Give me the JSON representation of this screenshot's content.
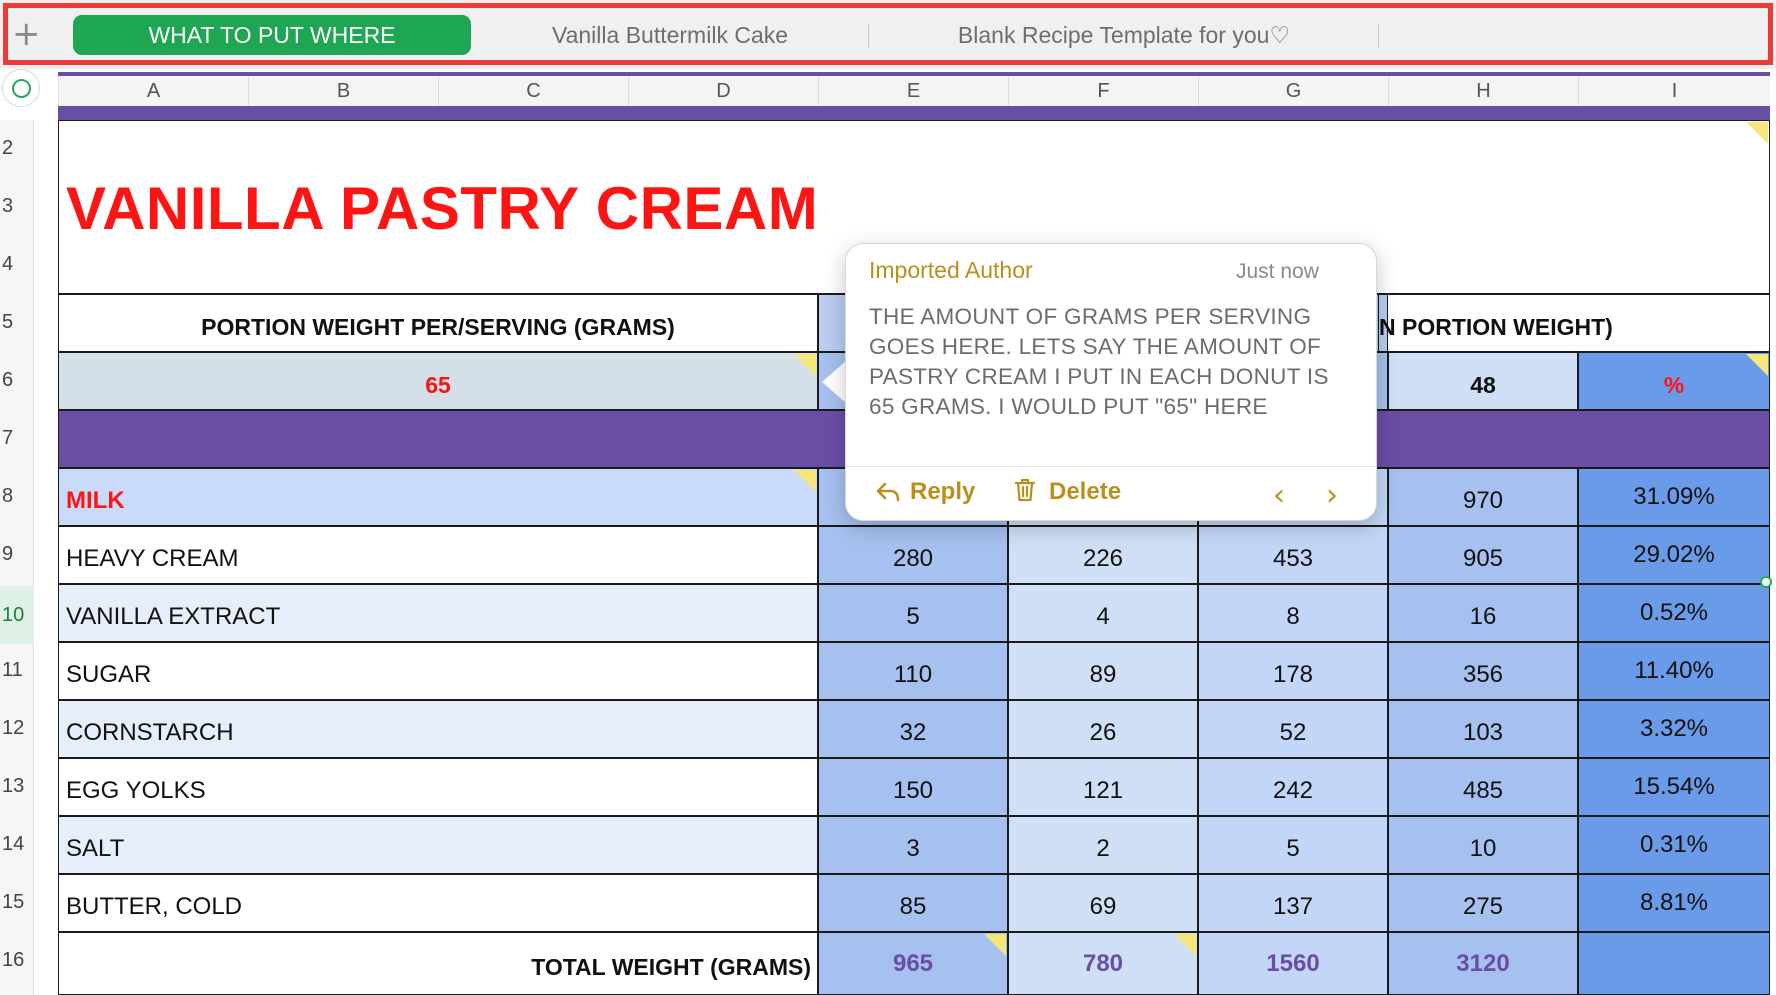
{
  "tabs": {
    "add_icon": "+",
    "items": [
      {
        "label": "WHAT TO PUT WHERE",
        "active": true
      },
      {
        "label": "Vanilla Buttermilk Cake",
        "active": false
      },
      {
        "label": "Blank Recipe Template for you♡",
        "active": false
      }
    ]
  },
  "columns": [
    "A",
    "B",
    "C",
    "D",
    "E",
    "F",
    "G",
    "H",
    "I"
  ],
  "rows": [
    "2",
    "3",
    "4",
    "5",
    "6",
    "7",
    "8",
    "9",
    "10",
    "11",
    "12",
    "13",
    "14",
    "15",
    "16"
  ],
  "sheet": {
    "title": "VANILLA PASTRY CREAM",
    "portion_label": "PORTION WEIGHT PER/SERVING (GRAMS)",
    "portion_value": "65",
    "h_header_fragment": "N PORTION WEIGHT)",
    "h6_value": "48",
    "i6_value": "%",
    "ingredients": [
      {
        "name": "MILK",
        "e": "",
        "f": "",
        "g": "",
        "h": "970",
        "pct": "31.09%"
      },
      {
        "name": "HEAVY CREAM",
        "e": "280",
        "f": "226",
        "g": "453",
        "h": "905",
        "pct": "29.02%"
      },
      {
        "name": "VANILLA EXTRACT",
        "e": "5",
        "f": "4",
        "g": "8",
        "h": "16",
        "pct": "0.52%"
      },
      {
        "name": "SUGAR",
        "e": "110",
        "f": "89",
        "g": "178",
        "h": "356",
        "pct": "11.40%"
      },
      {
        "name": "CORNSTARCH",
        "e": "32",
        "f": "26",
        "g": "52",
        "h": "103",
        "pct": "3.32%"
      },
      {
        "name": "EGG YOLKS",
        "e": "150",
        "f": "121",
        "g": "242",
        "h": "485",
        "pct": "15.54%"
      },
      {
        "name": "SALT",
        "e": "3",
        "f": "2",
        "g": "5",
        "h": "10",
        "pct": "0.31%"
      },
      {
        "name": "BUTTER, COLD",
        "e": "85",
        "f": "69",
        "g": "137",
        "h": "275",
        "pct": "8.81%"
      }
    ],
    "total_label": "TOTAL WEIGHT (GRAMS)",
    "totals": {
      "e": "965",
      "f": "780",
      "g": "1560",
      "h": "3120"
    }
  },
  "comment": {
    "author": "Imported Author",
    "time": "Just now",
    "body": "THE AMOUNT OF GRAMS PER SERVING GOES HERE. LETS SAY THE AMOUNT OF PASTRY CREAM I PUT IN EACH DONUT IS 65 GRAMS. I WOULD PUT \"65\" HERE",
    "reply_label": "Reply",
    "delete_label": "Delete",
    "prev_icon": "‹",
    "next_icon": "›"
  },
  "colors": {
    "accent_green": "#1fa653",
    "highlight_red": "#ee3b35",
    "title_red": "#ff1414",
    "band_purple": "#6a4ea6",
    "comment_gold": "#b98f1e",
    "total_purple": "#6a4ea6"
  }
}
